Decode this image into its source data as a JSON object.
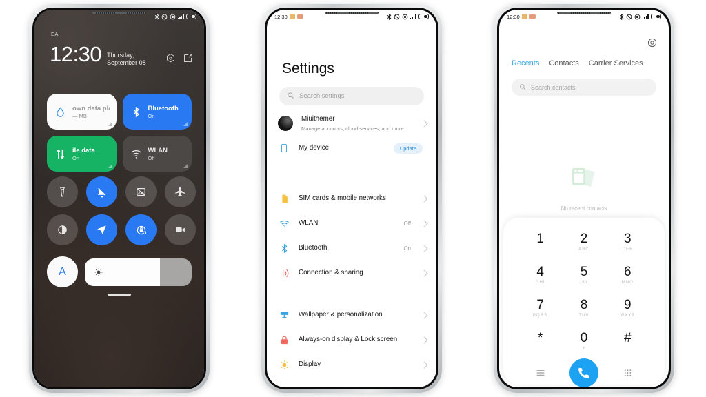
{
  "status_bar": {
    "time": "12:30",
    "carrier": "EA",
    "icons": [
      "bluetooth-icon",
      "dnd-icon",
      "location-icon",
      "signal-icon",
      "battery-icon"
    ]
  },
  "colors": {
    "accent_blue": "#2979f2",
    "tile_green": "#16b364",
    "dialer_blue": "#1da1f2",
    "tab_active": "#3ba4e0",
    "badge_blue": "#2b8ad8"
  },
  "control_center": {
    "carrier": "EA",
    "time": "12:30",
    "date": "Thursday, September 08",
    "actions": [
      "settings-gear-icon",
      "edit-icon"
    ],
    "tiles": [
      {
        "title": "own data plan",
        "sub": "— MB",
        "icon": "data-drop-icon",
        "style": "white"
      },
      {
        "title": "Bluetooth",
        "sub": "On",
        "icon": "bluetooth-icon",
        "style": "blue"
      },
      {
        "title": "ile data",
        "sub": "On",
        "icon": "mobile-data-icon",
        "style": "green"
      },
      {
        "title": "WLAN",
        "sub": "Off",
        "icon": "wifi-icon",
        "style": "grey"
      }
    ],
    "toggles": [
      {
        "name": "flashlight-icon",
        "state": "off"
      },
      {
        "name": "silent-mode-icon",
        "state": "on"
      },
      {
        "name": "screenshot-icon",
        "state": "off"
      },
      {
        "name": "airplane-mode-icon",
        "state": "off"
      },
      {
        "name": "dark-mode-icon",
        "state": "off"
      },
      {
        "name": "location-icon",
        "state": "on"
      },
      {
        "name": "rotation-lock-icon",
        "state": "on"
      },
      {
        "name": "screen-recorder-icon",
        "state": "off"
      }
    ],
    "auto_brightness_label": "A",
    "brightness_percent": 70
  },
  "settings": {
    "title": "Settings",
    "search_placeholder": "Search settings",
    "account": {
      "name": "Miuithemer",
      "subtitle": "Manage accounts, cloud services, and more"
    },
    "device": {
      "label": "My device",
      "badge": "Update"
    },
    "group_network": [
      {
        "label": "SIM cards & mobile networks",
        "value": "",
        "icon": "sim-card-icon"
      },
      {
        "label": "WLAN",
        "value": "Off",
        "icon": "wifi-icon"
      },
      {
        "label": "Bluetooth",
        "value": "On",
        "icon": "bluetooth-icon"
      },
      {
        "label": "Connection & sharing",
        "value": "",
        "icon": "connection-sharing-icon"
      }
    ],
    "group_display": [
      {
        "label": "Wallpaper & personalization",
        "value": "",
        "icon": "wallpaper-icon"
      },
      {
        "label": "Always-on display & Lock screen",
        "value": "",
        "icon": "lock-icon"
      },
      {
        "label": "Display",
        "value": "",
        "icon": "brightness-icon"
      }
    ]
  },
  "dialer": {
    "tabs": [
      {
        "label": "Recents",
        "active": true
      },
      {
        "label": "Contacts",
        "active": false
      },
      {
        "label": "Carrier Services",
        "active": false
      }
    ],
    "search_placeholder": "Search contacts",
    "empty_state": "No recent contacts",
    "keys": [
      {
        "num": "1",
        "sub": ""
      },
      {
        "num": "2",
        "sub": "ABC"
      },
      {
        "num": "3",
        "sub": "DEF"
      },
      {
        "num": "4",
        "sub": "GHI"
      },
      {
        "num": "5",
        "sub": "JKL"
      },
      {
        "num": "6",
        "sub": "MNO"
      },
      {
        "num": "7",
        "sub": "PQRS"
      },
      {
        "num": "8",
        "sub": "TUV"
      },
      {
        "num": "9",
        "sub": "WXYZ"
      },
      {
        "num": "*",
        "sub": ""
      },
      {
        "num": "0",
        "sub": "+"
      },
      {
        "num": "#",
        "sub": ""
      }
    ],
    "actions": [
      "menu-icon",
      "call-icon",
      "keypad-icon"
    ]
  }
}
